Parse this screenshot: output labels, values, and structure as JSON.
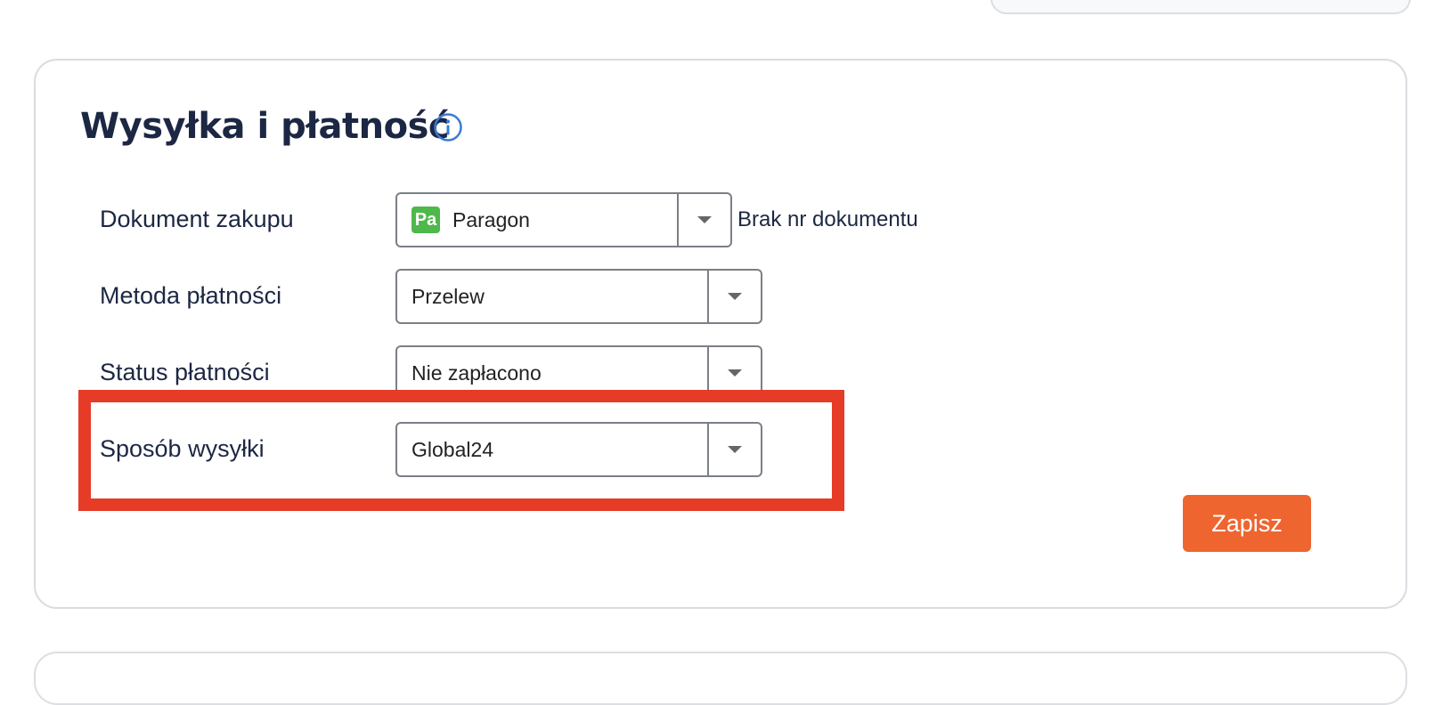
{
  "card": {
    "title": "Wysyłka i płatność",
    "info_icon": "info-circle-icon"
  },
  "rows": [
    {
      "label": "Dokument zakupu",
      "value": "Paragon",
      "badge": "Pa",
      "badge_color": "#4fb84b",
      "note": "Brak nr dokumentu"
    },
    {
      "label": "Metoda płatności",
      "value": "Przelew"
    },
    {
      "label": "Status płatności",
      "value": "Nie zapłacono"
    },
    {
      "label": "Sposób wysyłki",
      "value": "Global24"
    }
  ],
  "actions": {
    "save_label": "Zapisz"
  },
  "colors": {
    "title": "#1c2743",
    "accent": "#ee6530",
    "highlight": "#e63b26",
    "info": "#3a7bd5"
  }
}
